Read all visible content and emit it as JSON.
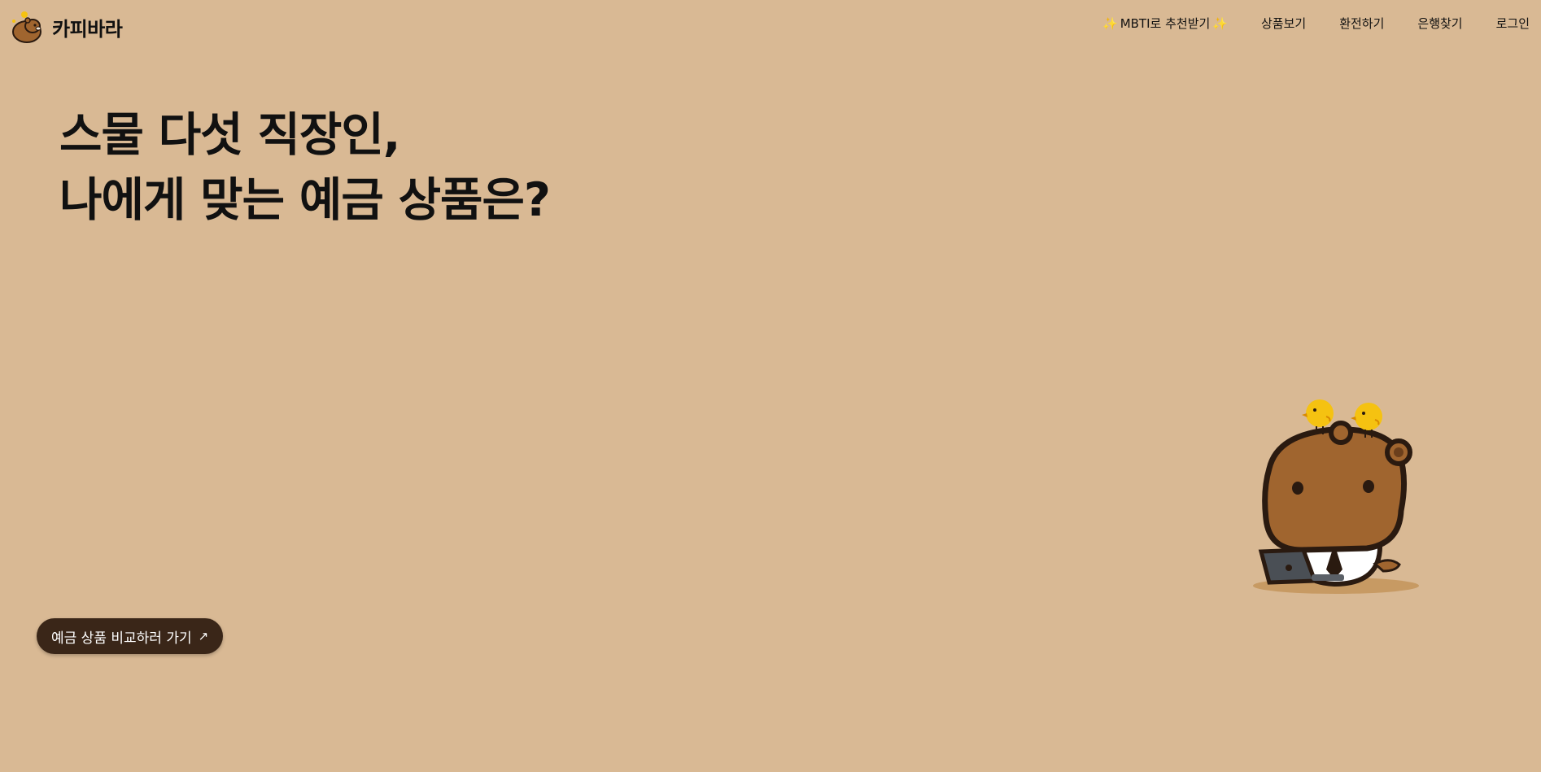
{
  "header": {
    "brand_name": "카피바라",
    "logo_icon": "capybara-logo-icon",
    "nav": {
      "mbti_label": "MBTI로 추천받기",
      "sparkle_icon": "sparkle-icon",
      "products_label": "상품보기",
      "exchange_label": "환전하기",
      "bank_finder_label": "은행찾기",
      "login_label": "로그인"
    }
  },
  "hero": {
    "line1": "스물 다섯 직장인,",
    "line2": "나에게 맞는 예금 상품은?"
  },
  "cta": {
    "label": "예금 상품 비교하러 가기",
    "arrow_glyph": "↗"
  },
  "illustration": {
    "name": "capybara-office-worker-illustration"
  },
  "colors": {
    "background": "#d9b994",
    "cta_background": "#3a2618",
    "capybara_fur": "#a0652f",
    "outline": "#2a1a10",
    "chick": "#f5c211"
  }
}
